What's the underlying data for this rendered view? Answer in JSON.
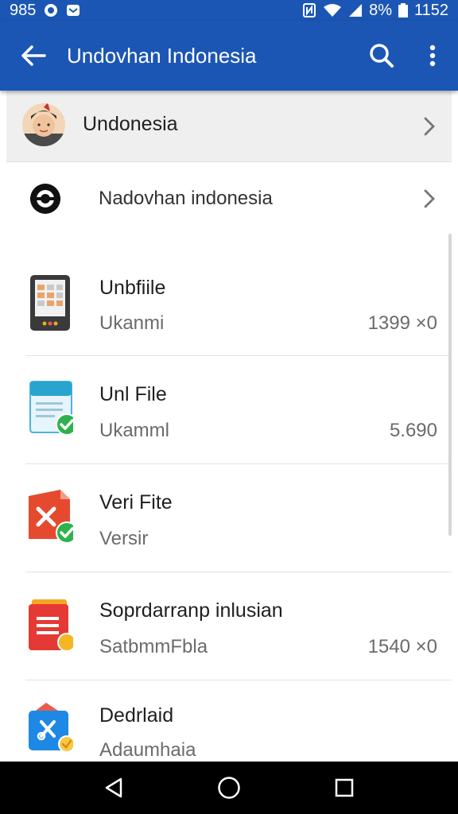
{
  "status_bar": {
    "left_text": "985",
    "battery_text": "8%",
    "time": "1152",
    "icons": [
      "notification-icon",
      "mail-icon",
      "nfc-icon",
      "wifi-icon",
      "signal-icon",
      "battery-icon"
    ]
  },
  "app_bar": {
    "title": "Undovhan Indonesia",
    "back_icon": "arrow-left-icon",
    "search_icon": "search-icon",
    "more_icon": "more-vert-icon",
    "color": "#1c56b4"
  },
  "header": {
    "label": "Undonesia"
  },
  "nav_item": {
    "label": "Nadovhan indonesia"
  },
  "files": [
    {
      "name": "Unbfiile",
      "sub": "Ukanmi",
      "size": "1399 ×0"
    },
    {
      "name": "Unl File",
      "sub": "Ukamml",
      "size": "5.690"
    },
    {
      "name": "Veri Fite",
      "sub": "Versir",
      "size": ""
    },
    {
      "name": "Soprdarranp inlusian",
      "sub": "SatbmmFbla",
      "size": "1540 ×0"
    },
    {
      "name": "Dedrlaid",
      "sub": "Adaumhaia",
      "size": ""
    }
  ],
  "nav_bar": {
    "back_icon": "nav-back-icon",
    "home_icon": "nav-home-icon",
    "recents_icon": "nav-recents-icon"
  }
}
